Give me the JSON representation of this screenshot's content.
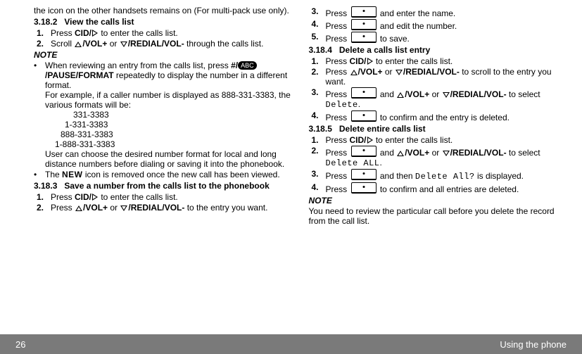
{
  "footer": {
    "page": "26",
    "title": "Using the phone"
  },
  "left": {
    "frag": "the icon on the other handsets remains on (For multi-pack use only).",
    "h182": {
      "num": "3.18.2",
      "title": "View the calls list"
    },
    "s182": {
      "1": {
        "pre": "Press ",
        "cid": "CID/",
        "post": " to enter the calls list."
      },
      "2": {
        "pre": "Scroll ",
        "volup": "/VOL+",
        "mid": " or ",
        "redial": "/REDIAL/VOL-",
        "post": " through the calls list."
      }
    },
    "noteLabel": "NOTE",
    "b1": {
      "pre": "When reviewing an entry from the calls list, press ",
      "hash": "#/",
      "abc": "ABC",
      "pf": "/PAUSE/FORMAT",
      "post": " repeatedly to display the number in a different format.",
      "eg": "For example, if a caller number is displayed as 888-331-3383, the various formats will be:",
      "f1": "331-3383",
      "f2": "1-331-3383",
      "f3": "888-331-3383",
      "f4": "1-888-331-3383",
      "tail": "User can choose the desired number format for local and long distance numbers before dialing or saving it into the phonebook."
    },
    "b2": {
      "pre": "The ",
      "new": "NEW",
      "post": " icon is removed once the new call has been viewed."
    },
    "h183": {
      "num": "3.18.3",
      "title": "Save a number from the calls list to the phonebook"
    },
    "s183": {
      "1": {
        "pre": "Press ",
        "cid": "CID/",
        "post": " to enter the calls list."
      },
      "2": {
        "pre": "Press ",
        "volup": "/VOL+",
        "mid": " or ",
        "redial": "/REDIAL/VOL-",
        "post": " to the entry you want."
      }
    }
  },
  "right": {
    "s183c": {
      "3": {
        "pre": "Press ",
        "post": " and enter the name."
      },
      "4": {
        "pre": "Press ",
        "post": " and edit the number."
      },
      "5": {
        "pre": "Press ",
        "post": " to save."
      }
    },
    "h184": {
      "num": "3.18.4",
      "title": "Delete a calls list entry"
    },
    "s184": {
      "1": {
        "pre": "Press ",
        "cid": "CID/",
        "post": " to enter the calls list."
      },
      "2": {
        "pre": "Press ",
        "volup": "/VOL+",
        "mid": " or ",
        "redial": "/REDIAL/VOL-",
        "post": " to scroll to the entry you want."
      },
      "3": {
        "pre": "Press ",
        "and": " and ",
        "volup": "/VOL+",
        "mid": " or ",
        "redial": "/REDIAL/VOL-",
        "post": " to select ",
        "sel": "Delete",
        "dot": "."
      },
      "4": {
        "pre": "Press ",
        "post": " to confirm and the entry is deleted."
      }
    },
    "h185": {
      "num": "3.18.5",
      "title": "Delete entire calls list"
    },
    "s185": {
      "1": {
        "pre": "Press ",
        "cid": "CID/",
        "post": " to enter the calls list."
      },
      "2": {
        "pre": "Press ",
        "and": " and ",
        "volup": "/VOL+",
        "mid": " or ",
        "redial": "/REDIAL/VOL-",
        "post": " to select ",
        "sel": "Delete ALL",
        "dot": "."
      },
      "3": {
        "pre": "Press ",
        "mid": " and then ",
        "sel": "Delete All?",
        "post": " is displayed."
      },
      "4": {
        "pre": "Press ",
        "post": " to confirm and all entries are deleted."
      }
    },
    "noteLabel": "NOTE",
    "noteBody": "You need to review the particular call before you delete the record from the call list."
  }
}
